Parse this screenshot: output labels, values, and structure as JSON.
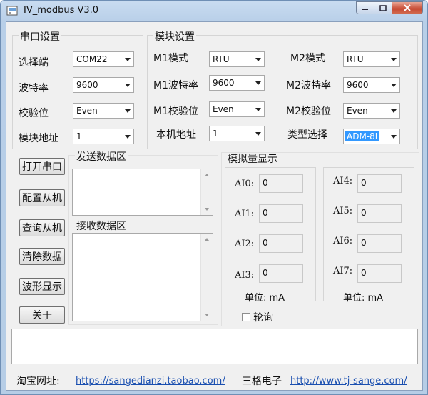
{
  "window": {
    "title": "IV_modbus V3.0"
  },
  "serial": {
    "title": "串口设置",
    "port_label": "选择端",
    "port_value": "COM22",
    "baud_label": "波特率",
    "baud_value": "9600",
    "parity_label": "校验位",
    "parity_value": "Even",
    "addr_label": "模块地址",
    "addr_value": "1"
  },
  "module": {
    "title": "模块设置",
    "m1_mode_label": "M1模式",
    "m1_mode_value": "RTU",
    "m2_mode_label": "M2模式",
    "m2_mode_value": "RTU",
    "m1_baud_label": "M1波特率",
    "m1_baud_value": "9600",
    "m2_baud_label": "M2波特率",
    "m2_baud_value": "9600",
    "m1_parity_label": "M1校验位",
    "m1_parity_value": "Even",
    "m2_parity_label": "M2校验位",
    "m2_parity_value": "Even",
    "local_addr_label": "本机地址",
    "local_addr_value": "1",
    "type_label": "类型选择",
    "type_value": "ADM-8I"
  },
  "buttons": {
    "open_port": "打开串口",
    "config_slave": "配置从机",
    "query_slave": "查询从机",
    "clear_data": "清除数据",
    "waveform": "波形显示",
    "about": "关于"
  },
  "send": {
    "title": "发送数据区"
  },
  "receive": {
    "title": "接收数据区"
  },
  "analog": {
    "title": "模拟量显示",
    "left": [
      {
        "label": "AI0:",
        "value": "0"
      },
      {
        "label": "AI1:",
        "value": "0"
      },
      {
        "label": "AI2:",
        "value": "0"
      },
      {
        "label": "AI3:",
        "value": "0"
      }
    ],
    "right": [
      {
        "label": "AI4:",
        "value": "0"
      },
      {
        "label": "AI5:",
        "value": "0"
      },
      {
        "label": "AI6:",
        "value": "0"
      },
      {
        "label": "AI7:",
        "value": "0"
      }
    ],
    "unit_left": "单位: mA",
    "unit_right": "单位: mA",
    "poll_label": "轮询"
  },
  "footer": {
    "shop_label": "淘宝网址:",
    "shop_url": "https://sangedianzi.taobao.com/",
    "company_label": "三格电子",
    "company_url": "http://www.tj-sange.com/"
  },
  "colors": {
    "link": "#1a4fb0",
    "selection": "#3399ff"
  }
}
